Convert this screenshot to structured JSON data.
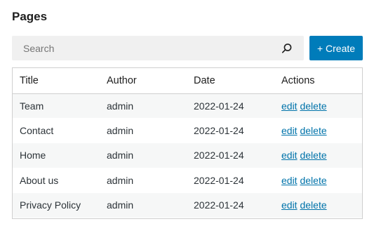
{
  "header": {
    "title": "Pages"
  },
  "search": {
    "placeholder": "Search",
    "value": ""
  },
  "toolbar": {
    "create_label": "+ Create"
  },
  "table": {
    "columns": [
      "Title",
      "Author",
      "Date",
      "Actions"
    ],
    "rows": [
      {
        "title": "Team",
        "author": "admin",
        "date": "2022-01-24",
        "edit": "edit",
        "delete": "delete"
      },
      {
        "title": "Contact",
        "author": "admin",
        "date": "2022-01-24",
        "edit": "edit",
        "delete": "delete"
      },
      {
        "title": "Home",
        "author": "admin",
        "date": "2022-01-24",
        "edit": "edit",
        "delete": "delete"
      },
      {
        "title": "About us",
        "author": "admin",
        "date": "2022-01-24",
        "edit": "edit",
        "delete": "delete"
      },
      {
        "title": "Privacy Policy",
        "author": "admin",
        "date": "2022-01-24",
        "edit": "edit",
        "delete": "delete"
      }
    ]
  },
  "colors": {
    "accent": "#007cba",
    "link": "#0073aa",
    "stripe": "#f6f7f7"
  },
  "icons": {
    "search": "search-icon"
  }
}
